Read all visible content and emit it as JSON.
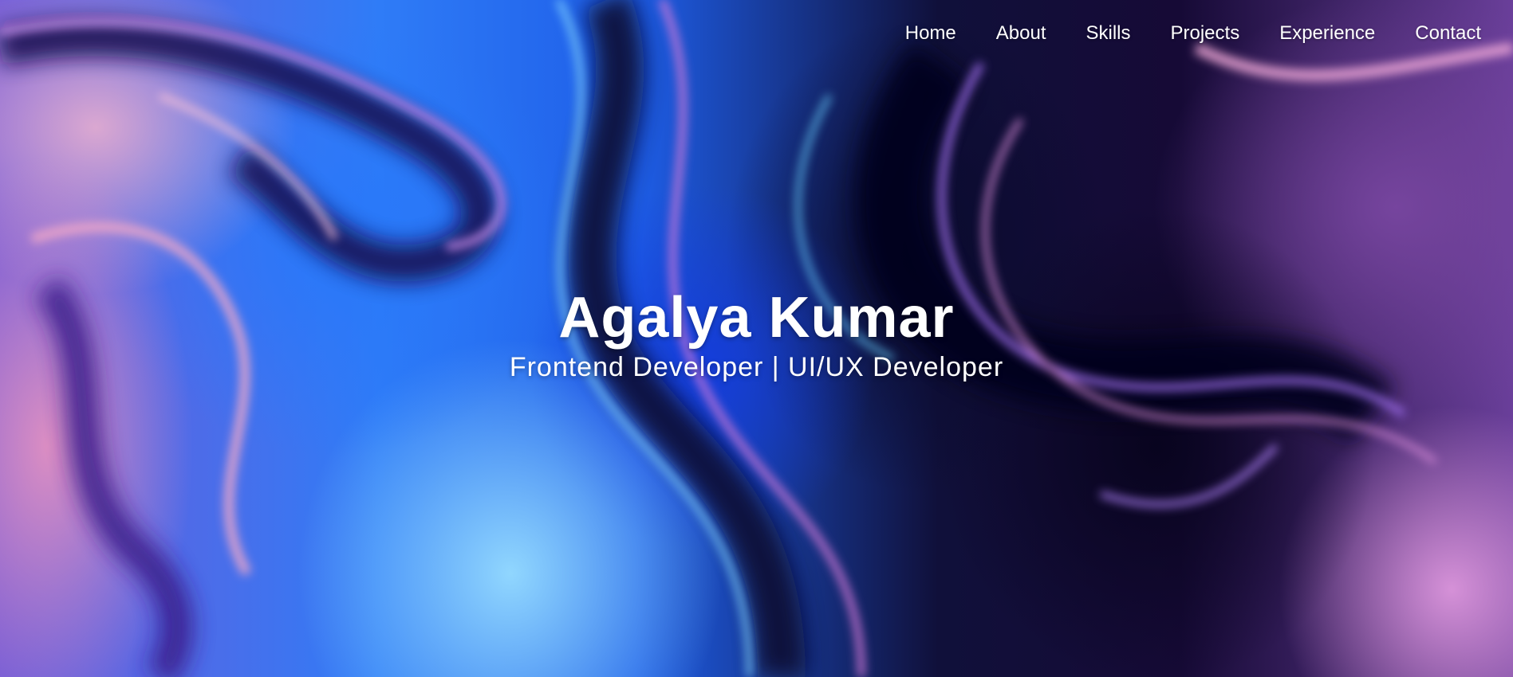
{
  "nav": {
    "items": [
      {
        "label": "Home"
      },
      {
        "label": "About"
      },
      {
        "label": "Skills"
      },
      {
        "label": "Projects"
      },
      {
        "label": "Experience"
      },
      {
        "label": "Contact"
      }
    ]
  },
  "hero": {
    "name": "Agalya Kumar",
    "tagline": "Frontend Developer | UI/UX Developer",
    "background": "abstract-liquid-swirl-image",
    "colors": {
      "text": "#ffffff",
      "blue": "#2f7cf7",
      "purple": "#6a3f9a",
      "pink": "#f096be",
      "dark": "#0a0620"
    }
  }
}
